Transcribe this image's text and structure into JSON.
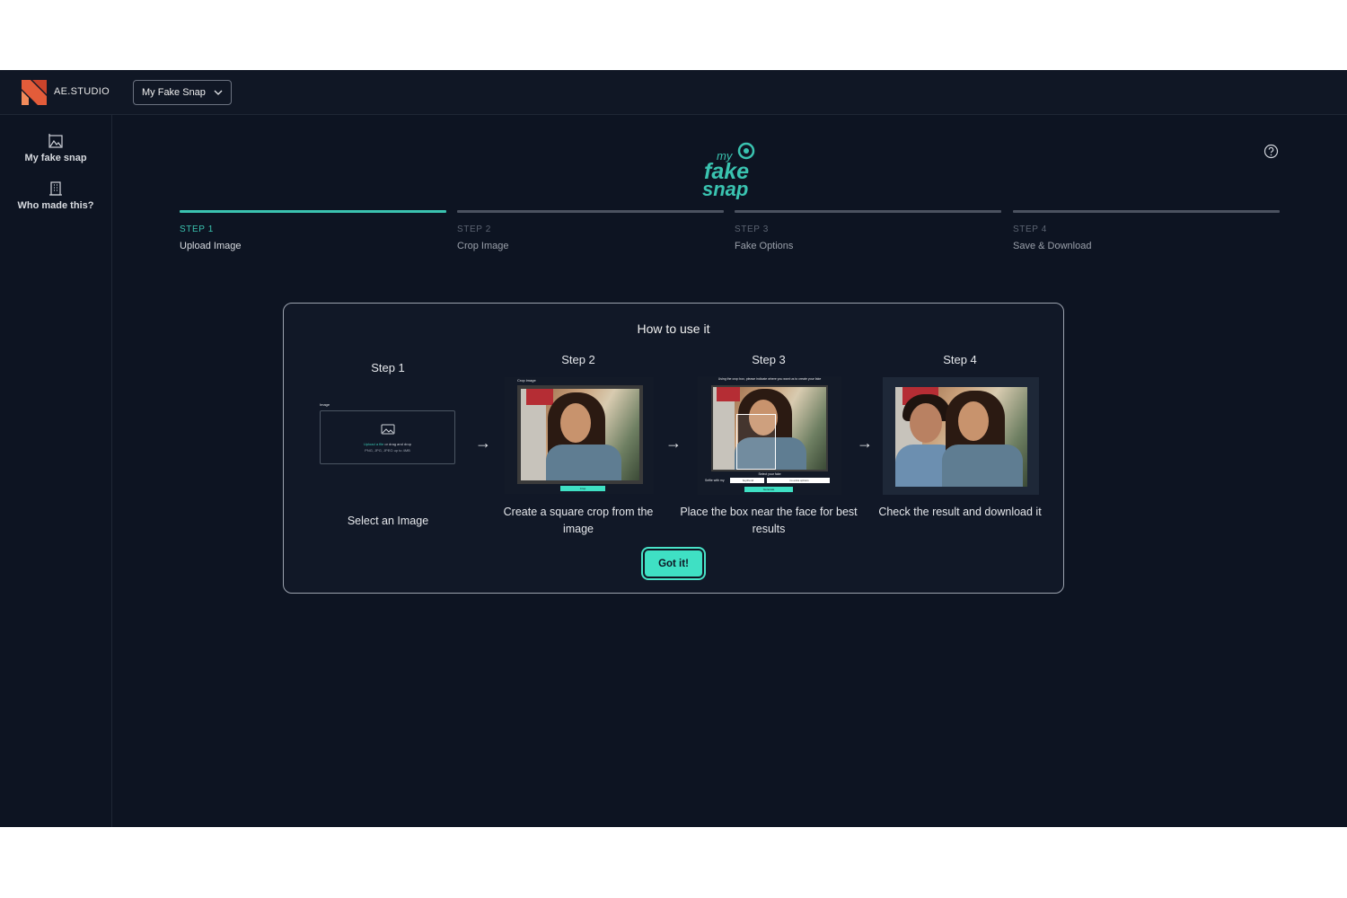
{
  "header": {
    "brand": "AE.STUDIO",
    "project_selector": "My Fake Snap"
  },
  "sidebar": {
    "items": [
      {
        "label": "My fake snap",
        "icon": "gallery-icon"
      },
      {
        "label": "Who made this?",
        "icon": "building-icon"
      }
    ]
  },
  "logo": {
    "line1": "my",
    "line2": "fake",
    "line3": "snap"
  },
  "steps": [
    {
      "number": "STEP 1",
      "name": "Upload Image",
      "active": true
    },
    {
      "number": "STEP 2",
      "name": "Crop Image",
      "active": false
    },
    {
      "number": "STEP 3",
      "name": "Fake Options",
      "active": false
    },
    {
      "number": "STEP 4",
      "name": "Save & Download",
      "active": false
    }
  ],
  "modal": {
    "title": "How to use it",
    "columns": [
      {
        "title": "Step 1",
        "description": "Select an Image"
      },
      {
        "title": "Step 2",
        "description": "Create a square crop from the image"
      },
      {
        "title": "Step 3",
        "description": "Place the box near the face for best results"
      },
      {
        "title": "Step 4",
        "description": "Check the result and download it"
      }
    ],
    "arrow": "→",
    "button": "Got it!",
    "thumb1": {
      "label": "Image",
      "upload_link": "Upload a file",
      "upload_rest": " or drag and drop",
      "hint": "PNG, JPG, JPEG up to 4MB"
    },
    "thumb2": {
      "label": "Crop image",
      "button": "Crop"
    },
    "thumb3": {
      "instruction": "Using the crop box, please indicate where you want us to create your fake",
      "section": "Select your fake",
      "field_label": "Selfie with my",
      "field1": "boyfriend",
      "field2": "no extra options",
      "button": "Generate"
    }
  },
  "colors": {
    "background": "#0d1422",
    "accent": "#3ac3b0",
    "button": "#3fe0c4"
  }
}
